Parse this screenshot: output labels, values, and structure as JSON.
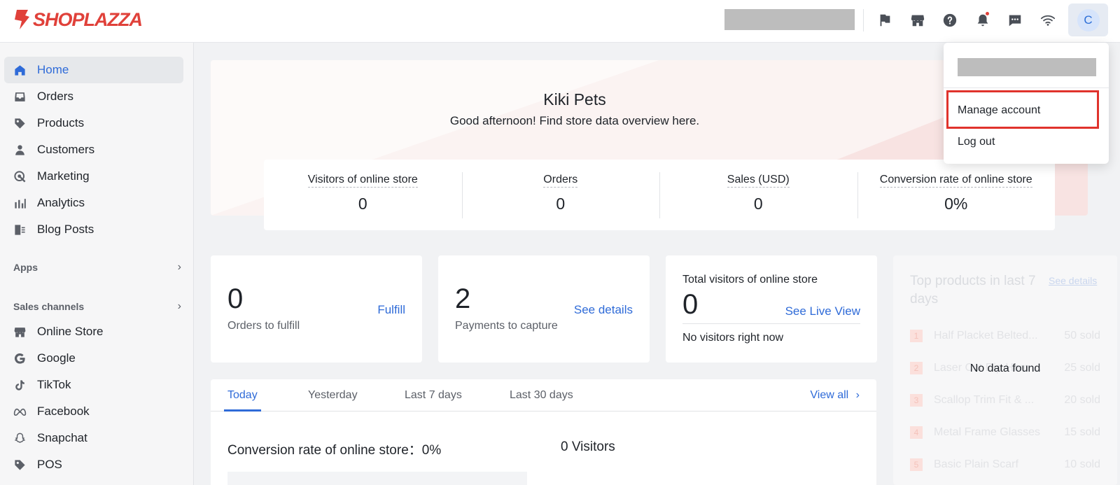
{
  "header": {
    "logo_text": "SHOPLAZZA",
    "avatar_initial": "C",
    "icons": [
      "flag-icon",
      "store-icon",
      "help-icon",
      "bell-icon",
      "chat-icon",
      "wifi-icon"
    ]
  },
  "sidebar": {
    "items": [
      {
        "label": "Home",
        "icon": "home-icon"
      },
      {
        "label": "Orders",
        "icon": "inbox-icon"
      },
      {
        "label": "Products",
        "icon": "tag-icon"
      },
      {
        "label": "Customers",
        "icon": "person-icon"
      },
      {
        "label": "Marketing",
        "icon": "target-icon"
      },
      {
        "label": "Analytics",
        "icon": "bar-chart-icon"
      },
      {
        "label": "Blog Posts",
        "icon": "blog-icon"
      }
    ],
    "apps_label": "Apps",
    "sales_channels_label": "Sales channels",
    "channels": [
      {
        "label": "Online Store",
        "icon": "store-icon"
      },
      {
        "label": "Google",
        "icon": "google-icon"
      },
      {
        "label": "TikTok",
        "icon": "tiktok-icon"
      },
      {
        "label": "Facebook",
        "icon": "meta-icon"
      },
      {
        "label": "Snapchat",
        "icon": "ghost-icon"
      },
      {
        "label": "POS",
        "icon": "tag-icon"
      }
    ]
  },
  "hero": {
    "store_name": "Kiki Pets",
    "greeting": "Good afternoon! Find store data overview here."
  },
  "stats": [
    {
      "title": "Visitors of online store",
      "value": "0"
    },
    {
      "title": "Orders",
      "value": "0"
    },
    {
      "title": "Sales (USD)",
      "value": "0"
    },
    {
      "title": "Conversion rate of online store",
      "value": "0%"
    }
  ],
  "cards": {
    "fulfill": {
      "value": "0",
      "label": "Orders to fulfill",
      "link": "Fulfill"
    },
    "payments": {
      "value": "2",
      "label": "Payments to capture",
      "link": "See details"
    },
    "visitors": {
      "title": "Total visitors of online store",
      "value": "0",
      "link": "See Live View",
      "status": "No visitors right now"
    }
  },
  "tabs": {
    "items": [
      "Today",
      "Yesterday",
      "Last 7 days",
      "Last 30 days"
    ],
    "active": "Today",
    "view_all": "View all",
    "conversion_label": "Conversion rate of online store：0%",
    "visitors_label": "0 Visitors"
  },
  "top_products": {
    "title": "Top products in last 7 days",
    "link": "See details",
    "no_data": "No data found",
    "rows": [
      {
        "rank": "1",
        "name": "Half Placket Belted...",
        "sold": "50 sold"
      },
      {
        "rank": "2",
        "name": "Laser Cut Dip Hem ...",
        "sold": "25 sold"
      },
      {
        "rank": "3",
        "name": "Scallop Trim Fit & ...",
        "sold": "20 sold"
      },
      {
        "rank": "4",
        "name": "Metal Frame Glasses",
        "sold": "15 sold"
      },
      {
        "rank": "5",
        "name": "Basic Plain Scarf",
        "sold": "10 sold"
      }
    ]
  },
  "dropdown": {
    "manage_account": "Manage account",
    "log_out": "Log out"
  },
  "colors": {
    "accent": "#2f6bd8",
    "brand": "#e0413a",
    "highlight": "#e0332c"
  }
}
